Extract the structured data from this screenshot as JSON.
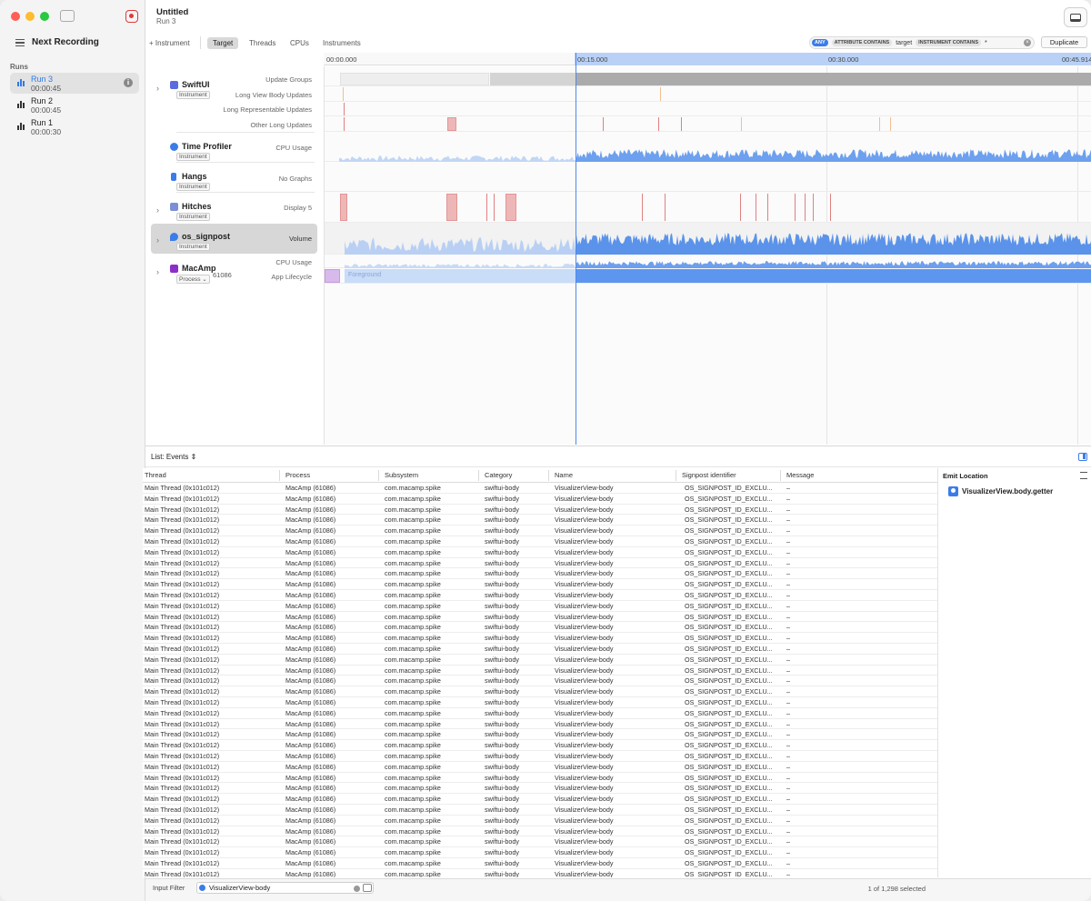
{
  "window": {
    "title": "Untitled",
    "subtitle": "Run 3"
  },
  "sidebar": {
    "next_recording": "Next Recording",
    "runs_title": "Runs",
    "runs": [
      {
        "name": "Run 3",
        "time": "00:00:45",
        "selected": true
      },
      {
        "name": "Run 2",
        "time": "00:00:45",
        "selected": false
      },
      {
        "name": "Run 1",
        "time": "00:00:30",
        "selected": false
      }
    ]
  },
  "toolbar": {
    "add_instrument": "+ Instrument",
    "tabs": [
      "Target",
      "Threads",
      "CPUs",
      "Instruments"
    ],
    "active_tab": "Target",
    "filter": {
      "any_pill": "ANY",
      "attr_pill": "ATTRIBUTE CONTAINS",
      "attr_value": "target",
      "instr_pill": "INSTRUMENT CONTAINS",
      "instr_value": "*"
    },
    "duplicate": "Duplicate"
  },
  "timeline": {
    "ticks": [
      "00:00.000",
      "00:15.000",
      "00:30.000",
      "00:45.914"
    ]
  },
  "instruments": [
    {
      "name": "SwiftUI",
      "tag": "Instrument",
      "subs": [
        "Update Groups",
        "Long View Body Updates",
        "Long Representable Updates",
        "Other Long Updates"
      ],
      "icon_color": "#5a6be0"
    },
    {
      "name": "Time Profiler",
      "tag": "Instrument",
      "subs": [
        "CPU Usage"
      ],
      "icon_color": "#3b7de8"
    },
    {
      "name": "Hangs",
      "tag": "Instrument",
      "subs": [
        "No Graphs"
      ],
      "icon_color": "#3b7de8"
    },
    {
      "name": "Hitches",
      "tag": "Instrument",
      "subs": [
        "Display 5"
      ],
      "icon_color": "#7a8fd8"
    },
    {
      "name": "os_signpost",
      "tag": "Instrument",
      "subs": [
        "Volume"
      ],
      "icon_color": "#3b7de8"
    },
    {
      "name": "MacAmp",
      "tag": "Process",
      "pid": "61086",
      "subs": [
        "CPU Usage",
        "App Lifecycle"
      ],
      "icon_color": "#8b2fc9"
    }
  ],
  "lifecycle_label": "Foreground",
  "detail": {
    "list_select": "List: Events",
    "columns": [
      "Thread",
      "Process",
      "Subsystem",
      "Category",
      "Name",
      "Signpost identifier",
      "Message"
    ],
    "row": {
      "thread": "Main Thread (0x101c012)",
      "process": "MacAmp (61086)",
      "subsystem": "com.macamp.spike",
      "category": "swiftui-body",
      "name": "VisualizerView-body",
      "signpost": "OS_SIGNPOST_ID_EXCLU...",
      "message": "–"
    },
    "row_count": 37
  },
  "inspector": {
    "title": "Emit Location",
    "item": "VisualizerView.body.getter"
  },
  "footer": {
    "filter_label": "Input Filter",
    "filter_value": "VisualizerView-body",
    "selection_count": "1 of 1,298 selected"
  }
}
